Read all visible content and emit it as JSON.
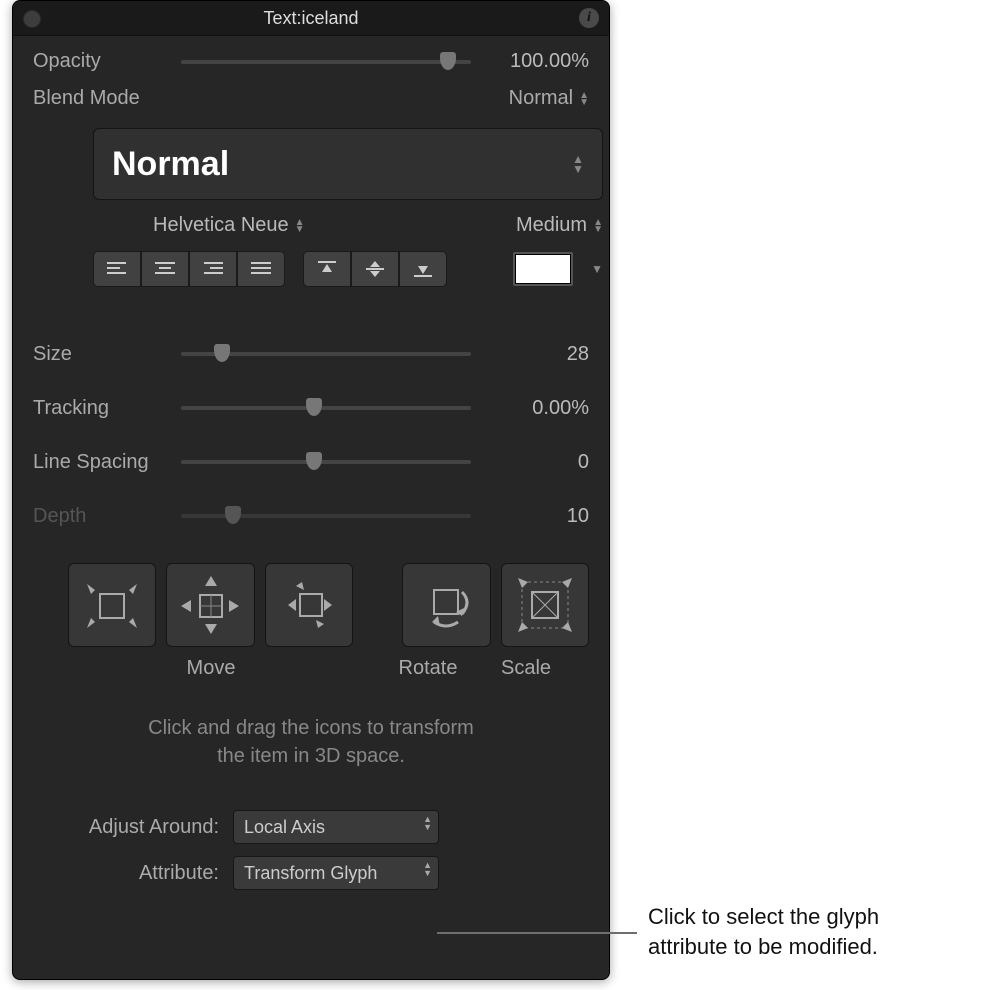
{
  "title": {
    "prefix": "Text:  ",
    "name": "iceland"
  },
  "opacity": {
    "label": "Opacity",
    "value": "100.00%",
    "thumb_pct": 92
  },
  "blendmode": {
    "label": "Blend Mode",
    "value": "Normal"
  },
  "style": {
    "name": "Normal",
    "font": "Helvetica Neue",
    "weight": "Medium"
  },
  "props": {
    "size": {
      "label": "Size",
      "value": "28",
      "thumb_pct": 14
    },
    "tracking": {
      "label": "Tracking",
      "value": "0.00%",
      "thumb_pct": 46
    },
    "lineSpacing": {
      "label": "Line Spacing",
      "value": "0",
      "thumb_pct": 46
    },
    "depth": {
      "label": "Depth",
      "value": "10",
      "thumb_pct": 18,
      "disabled": true
    }
  },
  "tool_labels": {
    "move": "Move",
    "rotate": "Rotate",
    "scale": "Scale"
  },
  "hint": {
    "line1": "Click and drag the icons to transform",
    "line2": "the item in 3D space."
  },
  "dropdowns": {
    "adjustAround": {
      "label": "Adjust Around:",
      "value": "Local Axis"
    },
    "attribute": {
      "label": "Attribute:",
      "value": "Transform Glyph"
    }
  },
  "callout": {
    "line1": "Click to select the glyph",
    "line2": "attribute to be modified."
  }
}
